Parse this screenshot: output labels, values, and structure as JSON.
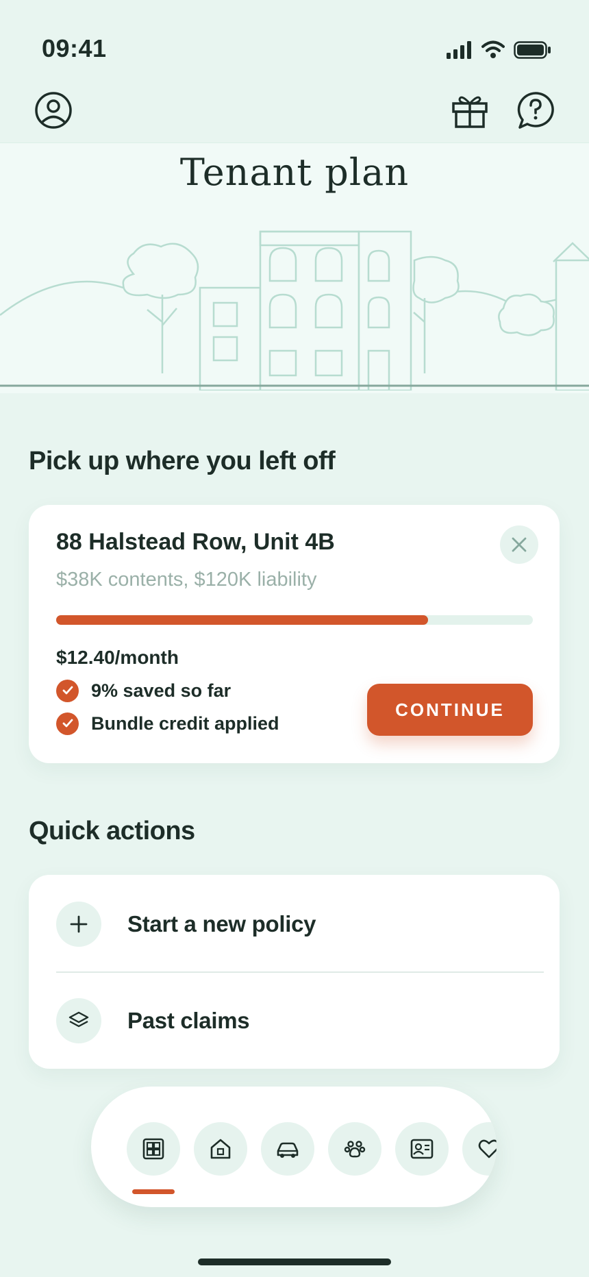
{
  "status_bar": {
    "time": "09:41"
  },
  "hero": {
    "title": "Tenant plan"
  },
  "resume": {
    "section_title": "Pick up where you left off",
    "address": "88 Halstead Row, Unit 4B",
    "coverage": "$38K contents, $120K liability",
    "progress_percent": 78,
    "price": "$12.40/month",
    "perks": [
      "9% saved so far",
      "Bundle credit applied"
    ],
    "continue_label": "CONTINUE"
  },
  "quick_actions": {
    "section_title": "Quick actions",
    "items": [
      {
        "label": "Start a new policy",
        "icon": "plus-icon"
      },
      {
        "label": "Past claims",
        "icon": "layers-icon"
      }
    ]
  },
  "bottom_nav": {
    "active_index": 0,
    "items": [
      "dashboard-icon",
      "home-icon",
      "car-icon",
      "paw-icon",
      "id-card-icon",
      "heart-icon"
    ]
  },
  "colors": {
    "background": "#e8f5f0",
    "accent": "#d2562b",
    "text": "#1d2d28",
    "muted": "#9ab0a8"
  }
}
